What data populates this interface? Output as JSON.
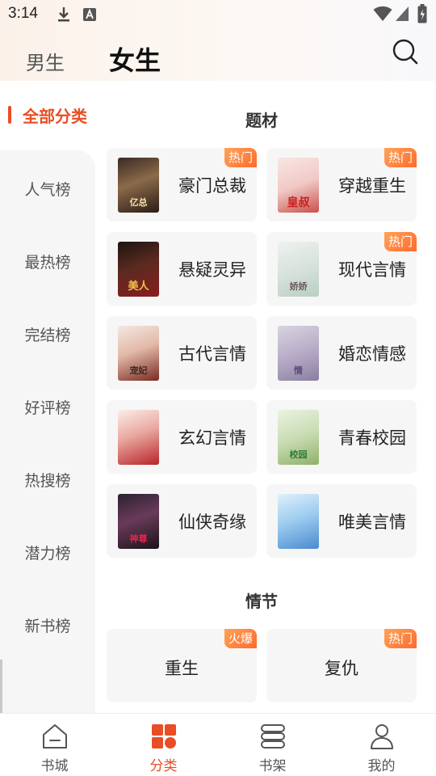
{
  "status_bar": {
    "time": "3:14"
  },
  "header": {
    "tabs": [
      {
        "label": "男生",
        "active": false
      },
      {
        "label": "女生",
        "active": true
      }
    ]
  },
  "sidebar": {
    "items": [
      {
        "label": "全部分类",
        "active": true
      },
      {
        "label": "人气榜"
      },
      {
        "label": "最热榜"
      },
      {
        "label": "完结榜"
      },
      {
        "label": "好评榜"
      },
      {
        "label": "热搜榜"
      },
      {
        "label": "潜力榜"
      },
      {
        "label": "新书榜"
      }
    ]
  },
  "sections": [
    {
      "title": "题材",
      "items": [
        {
          "label": "豪门总裁",
          "badge": "热门",
          "cover_text": "亿总"
        },
        {
          "label": "穿越重生",
          "badge": "热门",
          "cover_text": "皇叔"
        },
        {
          "label": "悬疑灵异",
          "badge": "",
          "cover_text": "美人"
        },
        {
          "label": "现代言情",
          "badge": "热门",
          "cover_text": "娇娇"
        },
        {
          "label": "古代言情",
          "badge": "",
          "cover_text": "宠妃"
        },
        {
          "label": "婚恋情感",
          "badge": "",
          "cover_text": "情"
        },
        {
          "label": "玄幻言情",
          "badge": "",
          "cover_text": ""
        },
        {
          "label": "青春校园",
          "badge": "",
          "cover_text": "校园"
        },
        {
          "label": "仙侠奇缘",
          "badge": "",
          "cover_text": "神尊"
        },
        {
          "label": "唯美言情",
          "badge": "",
          "cover_text": ""
        }
      ]
    },
    {
      "title": "情节",
      "items": [
        {
          "label": "重生",
          "badge": "火爆"
        },
        {
          "label": "复仇",
          "badge": "热门"
        }
      ]
    }
  ],
  "bottom_nav": [
    {
      "label": "书城",
      "icon": "home-icon",
      "active": false
    },
    {
      "label": "分类",
      "icon": "category-icon",
      "active": true
    },
    {
      "label": "书架",
      "icon": "bookshelf-icon",
      "active": false
    },
    {
      "label": "我的",
      "icon": "profile-icon",
      "active": false
    }
  ],
  "colors": {
    "accent": "#e84e26",
    "badge": "#ff7a35",
    "card_bg": "#f6f6f6",
    "sidebar_bg": "#f6f6f6"
  }
}
